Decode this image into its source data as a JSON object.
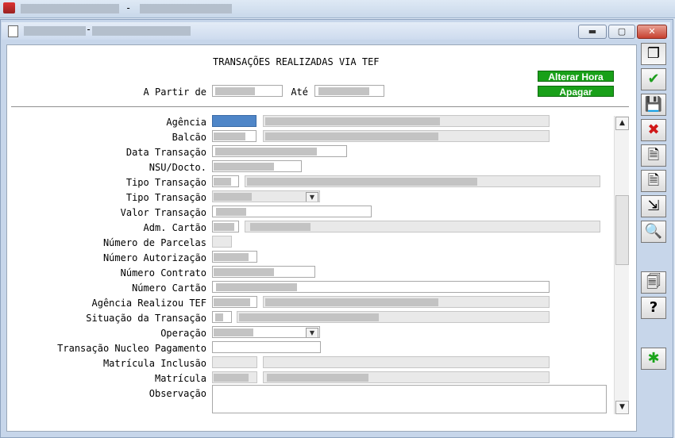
{
  "window": {
    "dash": "-",
    "minimize_glyph": "▬",
    "maximize_glyph": "▢",
    "close_glyph": "✕"
  },
  "form": {
    "title": "TRANSAÇÕES REALIZADAS VIA TEF",
    "a_partir_label": "A Partir de",
    "ate_label": "Até",
    "alterar_hora": "Alterar Hora",
    "apagar": "Apagar",
    "labels": {
      "agencia": "Agência",
      "balcao": "Balcão",
      "data_transacao": "Data Transação",
      "nsu": "NSU/Docto.",
      "tipo_transacao_1": "Tipo Transação",
      "tipo_transacao_2": "Tipo Transação",
      "valor_transacao": "Valor Transação",
      "adm_cartao": "Adm. Cartão",
      "numero_parcelas": "Número de Parcelas",
      "numero_autorizacao": "Número Autorização",
      "numero_contrato": "Número Contrato",
      "numero_cartao": "Número Cartão",
      "agencia_realizou": "Agência Realizou TEF",
      "situacao": "Situação da Transação",
      "operacao": "Operação",
      "transacao_nucleo": "Transação Nucleo Pagamento",
      "matricula_inclusao": "Matrícula Inclusão",
      "matricula": "Matrícula",
      "observacao": "Observação"
    },
    "combo_arrow": "▼"
  },
  "scrollbar": {
    "up": "▲",
    "down": "▼"
  },
  "toolbar": [
    {
      "name": "restore-icon",
      "glyph": "❐"
    },
    {
      "name": "confirm-check-icon",
      "glyph": "✔",
      "color": "#1e9e1e"
    },
    {
      "name": "save-disk-icon",
      "glyph": "💾"
    },
    {
      "name": "cancel-x-icon",
      "glyph": "✖",
      "color": "#d01818"
    },
    {
      "name": "add-record-icon",
      "glyph": "🗎"
    },
    {
      "name": "delete-record-icon",
      "glyph": "🗎"
    },
    {
      "name": "export-icon",
      "glyph": "⇲"
    },
    {
      "name": "search-icon",
      "glyph": "🔍"
    },
    {
      "name": "print-icon",
      "glyph": "🗐"
    },
    {
      "name": "help-icon",
      "glyph": "?"
    },
    {
      "name": "asterisk-icon",
      "glyph": "✱",
      "color": "#1aa41a"
    }
  ],
  "colors": {
    "green_button": "#19a019",
    "selected_field": "#4f86c8"
  }
}
